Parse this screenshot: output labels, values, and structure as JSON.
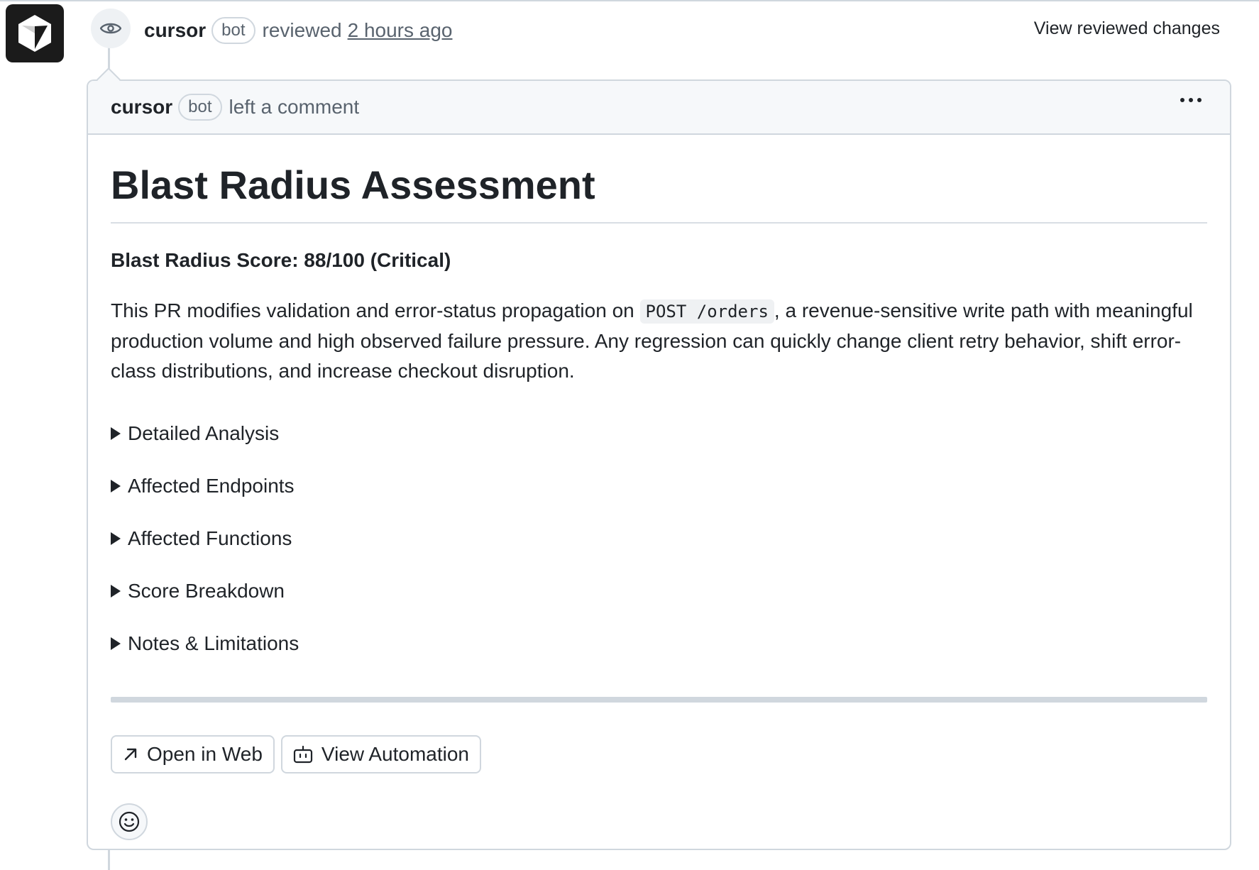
{
  "review": {
    "author": "cursor",
    "badge": "bot",
    "action": "reviewed",
    "time": "2 hours ago",
    "view_changes": "View reviewed changes"
  },
  "comment": {
    "author": "cursor",
    "badge": "bot",
    "action": "left a comment",
    "title": "Blast Radius Assessment",
    "score": "Blast Radius Score: 88/100 (Critical)",
    "desc_before": "This PR modifies validation and error-status propagation on",
    "desc_code": "POST /orders",
    "desc_after": ", a revenue-sensitive write path with meaningful production volume and high observed failure pressure. Any regression can quickly change client retry behavior, shift error-class distributions, and increase checkout disruption.",
    "details": [
      {
        "label": "Detailed Analysis"
      },
      {
        "label": "Affected Endpoints"
      },
      {
        "label": "Affected Functions"
      },
      {
        "label": "Score Breakdown"
      },
      {
        "label": "Notes & Limitations"
      }
    ],
    "buttons": {
      "open_web": "Open in Web",
      "view_automation": "View Automation"
    }
  },
  "icons": {
    "avatar": "cursor-logo-icon",
    "review": "eye-icon",
    "more": "kebab-icon",
    "open_web": "arrow-up-right-icon",
    "automation": "robot-icon",
    "reaction": "smiley-icon"
  }
}
